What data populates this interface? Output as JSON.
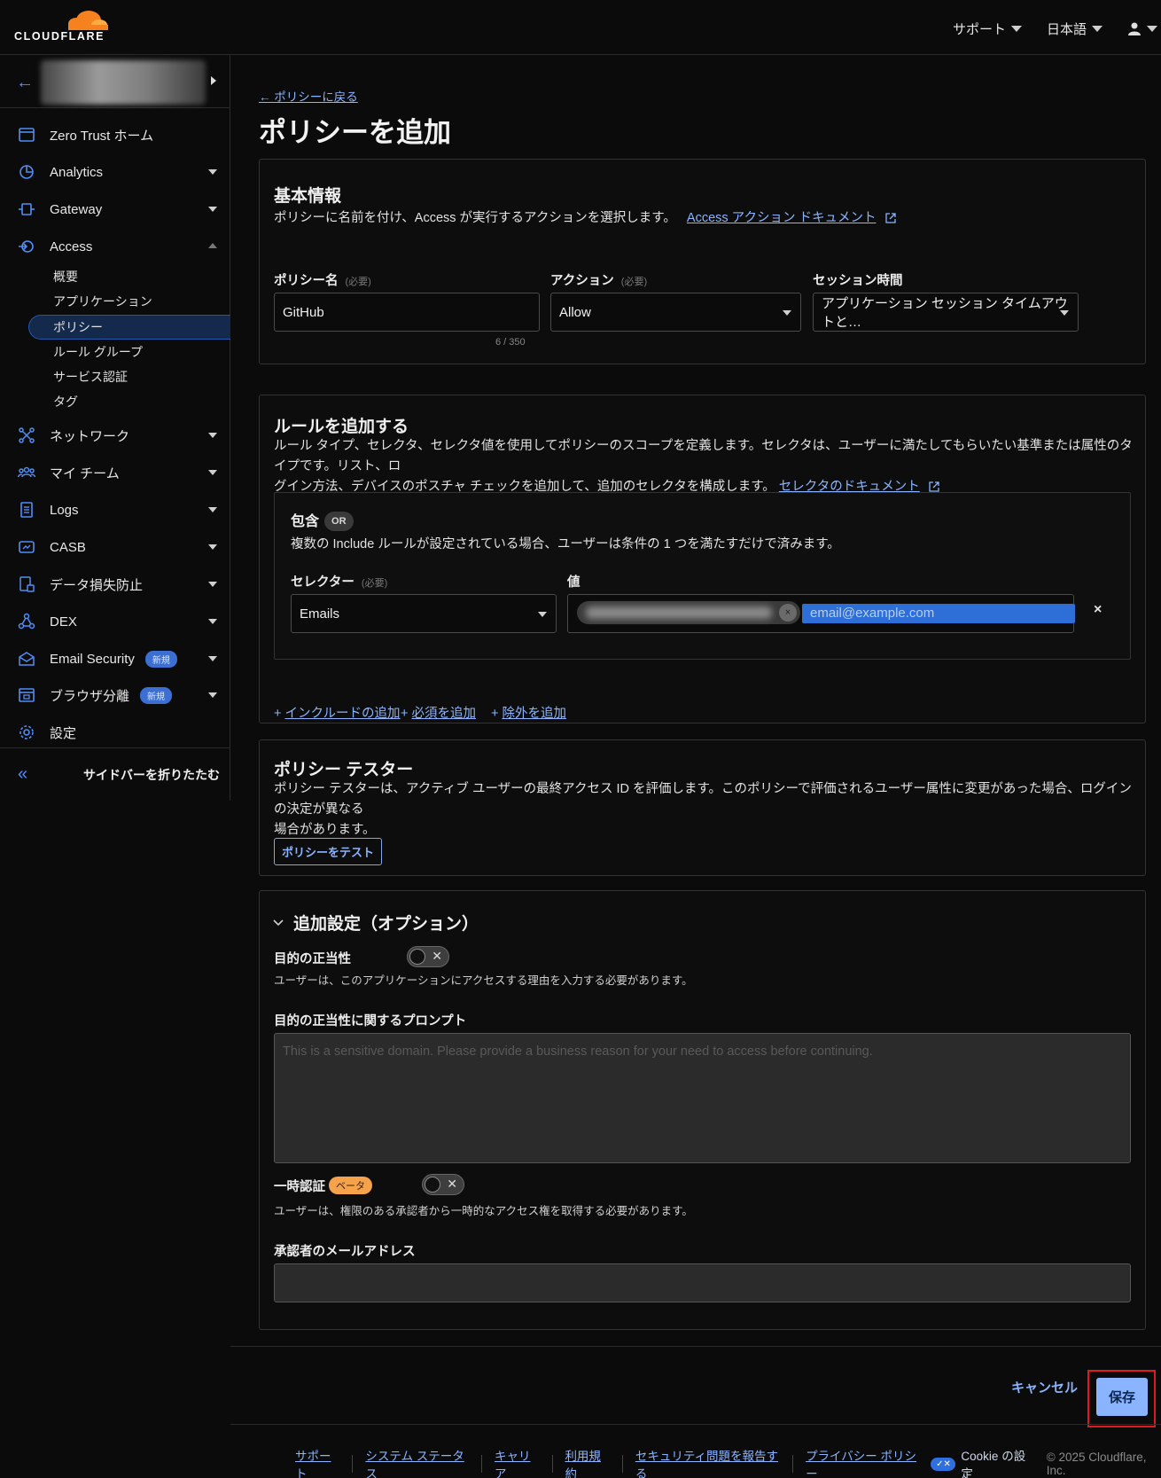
{
  "header": {
    "logo_text": "CLOUDFLARE",
    "support": "サポート",
    "language": "日本語"
  },
  "sidebar": {
    "collapse_label": "サイドバーを折りたたむ",
    "items": [
      {
        "label": "Zero Trust ホーム"
      },
      {
        "label": "Analytics"
      },
      {
        "label": "Gateway"
      },
      {
        "label": "Access"
      },
      {
        "label": "ネットワーク"
      },
      {
        "label": "マイ チーム"
      },
      {
        "label": "Logs"
      },
      {
        "label": "CASB"
      },
      {
        "label": "データ損失防止"
      },
      {
        "label": "DEX"
      },
      {
        "label": "Email Security",
        "badge": "新規"
      },
      {
        "label": "ブラウザ分離",
        "badge": "新規"
      },
      {
        "label": "設定"
      }
    ],
    "access_sub": [
      "概要",
      "アプリケーション",
      "ポリシー",
      "ルール グループ",
      "サービス認証",
      "タグ"
    ]
  },
  "page": {
    "back_link": "← ポリシーに戻る",
    "title": "ポリシーを追加"
  },
  "basic": {
    "title": "基本情報",
    "desc": "ポリシーに名前を付け、Access が実行するアクションを選択します。",
    "doc_link": "Access アクション ドキュメント",
    "required": "(必要)",
    "policy_name_label": "ポリシー名",
    "policy_name_value": "GitHub",
    "counter": "6 / 350",
    "action_label": "アクション",
    "action_value": "Allow",
    "session_label": "セッション時間",
    "session_value": "アプリケーション セッション タイムアウトと…"
  },
  "rules": {
    "title": "ルールを追加する",
    "desc_line1": "ルール タイプ、セレクタ、セレクタ値を使用してポリシーのスコープを定義します。セレクタは、ユーザーに満たしてもらいたい基準または属性のタイプです。リスト、ロ",
    "desc_line2": "グイン方法、デバイスのポスチャ チェックを追加して、追加のセレクタを構成します。",
    "doc_link": "セレクタのドキュメント",
    "include_title": "包含",
    "or_label": "OR",
    "include_desc": "複数の Include ルールが設定されている場合、ユーザーは条件の 1 つを満たすだけで済みます。",
    "selector_label": "セレクター",
    "required": "(必要)",
    "selector_value": "Emails",
    "value_label": "値",
    "email_placeholder": "email@example.com",
    "chip_remove": "×",
    "row_remove": "×",
    "add_include": "インクルードの追加",
    "add_require": "必須を追加",
    "add_exclude": "除外を追加"
  },
  "tester": {
    "title": "ポリシー テスター",
    "desc_line1": "ポリシー テスターは、アクティブ ユーザーの最終アクセス ID を評価します。このポリシーで評価されるユーザー属性に変更があった場合、ログインの決定が異なる",
    "desc_line2": "場合があります。",
    "button": "ポリシーをテスト"
  },
  "advanced": {
    "title": "追加設定（オプション）",
    "purpose_label": "目的の正当性",
    "purpose_hint": "ユーザーは、このアプリケーションにアクセスする理由を入力する必要があります。",
    "prompt_label": "目的の正当性に関するプロンプト",
    "prompt_placeholder": "This is a sensitive domain. Please provide a business reason for your need to access before continuing.",
    "temp_label": "一時認証",
    "beta": "ベータ",
    "temp_hint": "ユーザーは、権限のある承認者から一時的なアクセス権を取得する必要があります。",
    "approver_label": "承認者のメールアドレス",
    "toggle_x": "✕"
  },
  "actions": {
    "cancel": "キャンセル",
    "save": "保存"
  },
  "footer": {
    "links": [
      "サポート",
      "システム ステータス",
      "キャリア",
      "利用規約",
      "セキュリティ問題を報告する",
      "プライバシー ポリシー"
    ],
    "cookie": "Cookie の設定",
    "copyright": "© 2025 Cloudflare, Inc."
  },
  "colors": {
    "accent": "#8ab4ff",
    "brand_orange": "#f6821f",
    "highlight_red": "#e0191d"
  }
}
